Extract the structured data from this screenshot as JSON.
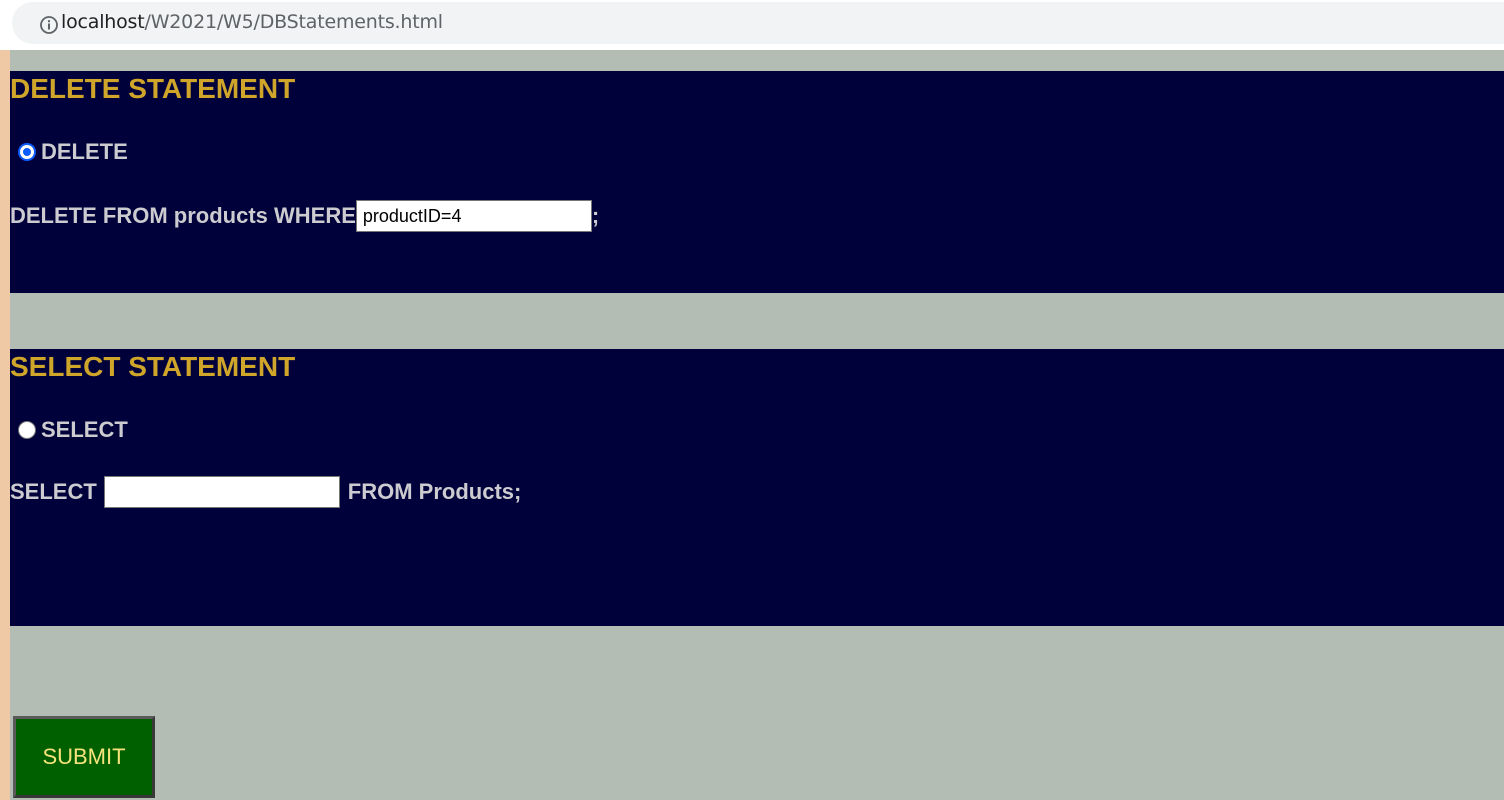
{
  "browser": {
    "url_host": "localhost",
    "url_path": "/W2021/W5/DBStatements.html"
  },
  "delete_section": {
    "title": "DELETE STATEMENT",
    "radio_label": "DELETE",
    "radio_checked": true,
    "prefix": "DELETE FROM products WHERE",
    "input_value": "productID=4",
    "suffix": ";"
  },
  "select_section": {
    "title": "SELECT STATEMENT",
    "radio_label": "SELECT",
    "radio_checked": false,
    "prefix": "SELECT",
    "input_value": "",
    "suffix": "FROM Products;"
  },
  "submit_label": "SUBMIT",
  "colors": {
    "page_bg": "#b3bdb4",
    "panel_bg": "#00003b",
    "title": "#cfa52a",
    "text": "#cbcbd0",
    "submit_bg": "#006000",
    "submit_text": "#f5e27a"
  }
}
